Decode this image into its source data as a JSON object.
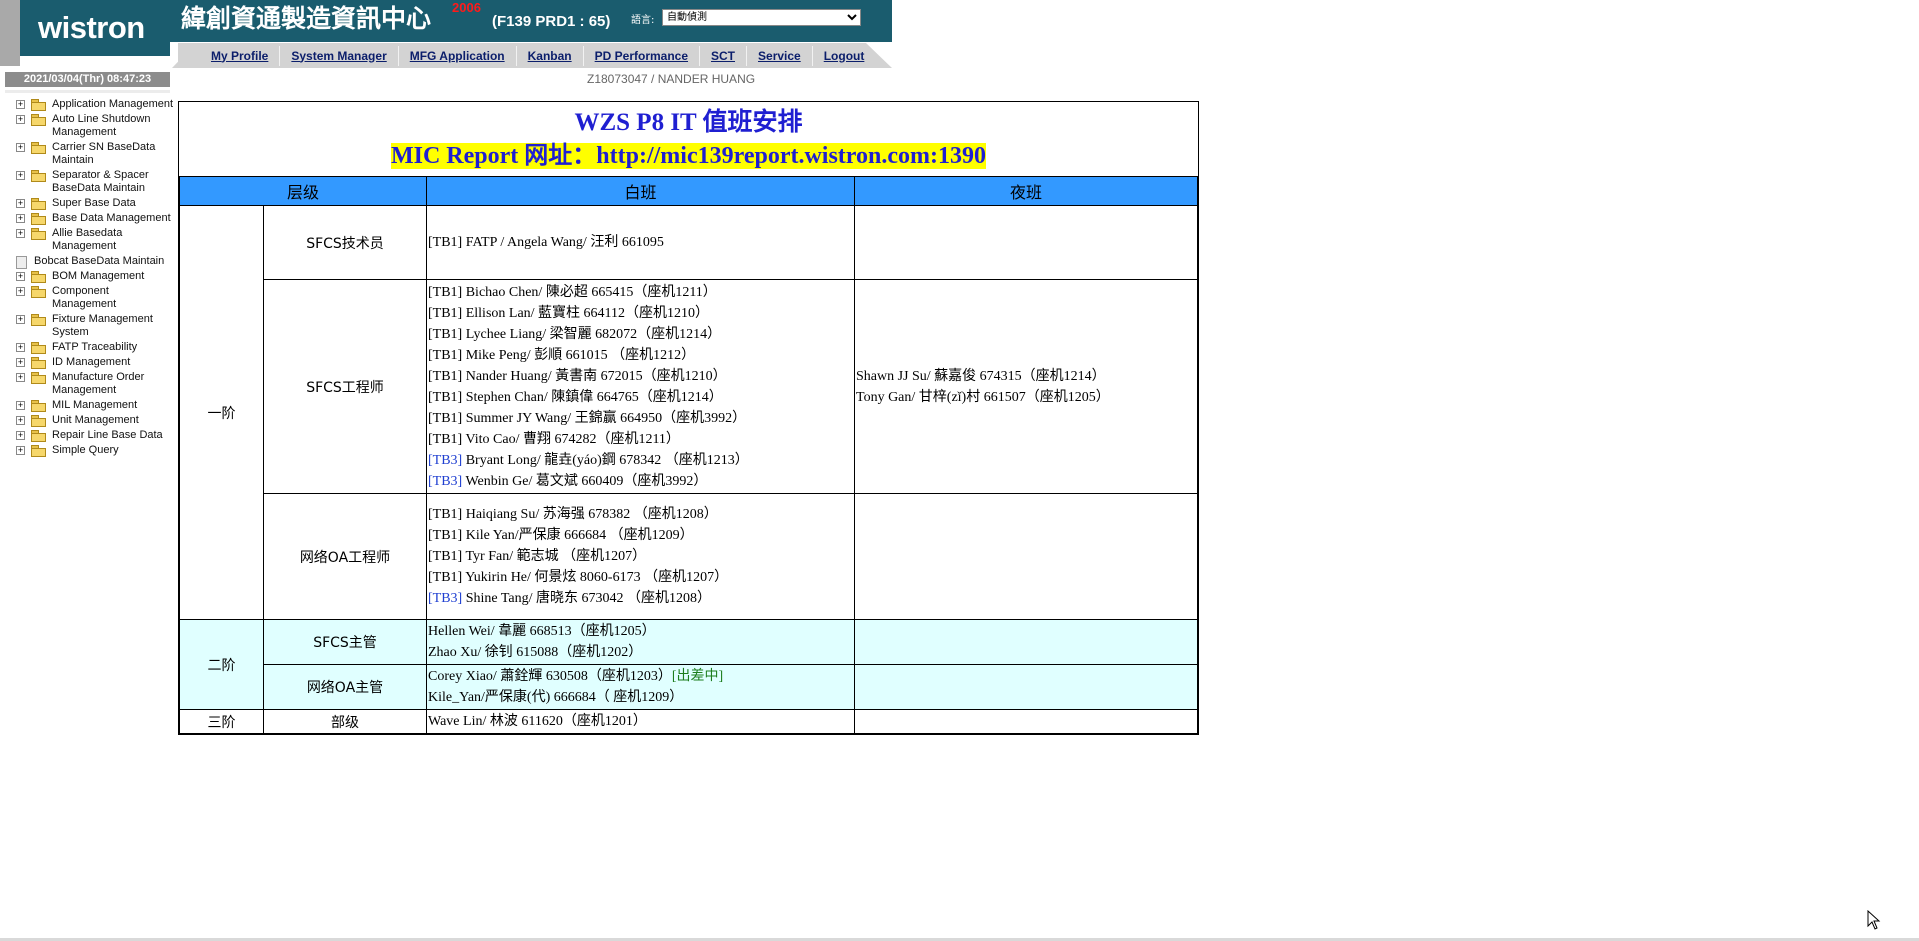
{
  "header": {
    "logo": "wistron",
    "system_title": "緯創資通製造資訊中心",
    "badge": "2006",
    "server": "(F139 PRD1 : 65)",
    "language_label": "語言:",
    "language_value": "自動偵測",
    "colors": {
      "header_bg": "#1a5c6e",
      "nav_bg": "#d3d3d3",
      "badge": "#ff1a1a"
    }
  },
  "nav": {
    "items": [
      "My Profile",
      "System Manager",
      "MFG Application",
      "Kanban",
      "PD Performance",
      "SCT",
      "Service",
      "Logout"
    ]
  },
  "datetime": "2021/03/04(Thr) 08:47:23",
  "user": "Z18073047 / NANDER HUANG",
  "sidebar": {
    "items": [
      {
        "label": "Application Management",
        "icon": "folder-icon"
      },
      {
        "label": "Auto Line Shutdown Management",
        "icon": "folder-icon"
      },
      {
        "label": "Carrier SN BaseData Maintain",
        "icon": "folder-icon"
      },
      {
        "label": "Separator & Spacer BaseData Maintain",
        "icon": "folder-icon"
      },
      {
        "label": "Super Base Data",
        "icon": "folder-icon"
      },
      {
        "label": "Base Data Management",
        "icon": "folder-icon"
      },
      {
        "label": "Allie Basedata Management",
        "icon": "folder-icon"
      },
      {
        "label": "Bobcat BaseData Maintain",
        "icon": "document-icon"
      },
      {
        "label": "BOM Management",
        "icon": "folder-icon"
      },
      {
        "label": "Component Management",
        "icon": "folder-icon"
      },
      {
        "label": "Fixture Management System",
        "icon": "folder-icon"
      },
      {
        "label": "FATP Traceability",
        "icon": "folder-icon"
      },
      {
        "label": "ID Management",
        "icon": "folder-icon"
      },
      {
        "label": "Manufacture Order Management",
        "icon": "folder-icon"
      },
      {
        "label": "MIL Management",
        "icon": "folder-icon"
      },
      {
        "label": "Unit Management",
        "icon": "folder-icon"
      },
      {
        "label": "Repair Line Base Data",
        "icon": "folder-icon"
      },
      {
        "label": "Simple Query",
        "icon": "folder-icon"
      }
    ]
  },
  "duty": {
    "title": "WZS P8 IT  值班安排",
    "report": "MIC Report 网址：http://mic139report.wistron.com:1390",
    "columns": {
      "level": "层级",
      "day": "白班",
      "night": "夜班"
    },
    "levels": {
      "l1": "一阶",
      "l2": "二阶",
      "l3": "三阶"
    },
    "roles": {
      "sfcs_tech": "SFCS技术员",
      "sfcs_eng": "SFCS工程师",
      "oa_eng": "网络OA工程师",
      "sfcs_mgr": "SFCS主管",
      "oa_mgr": "网络OA主管",
      "dept": "部级"
    },
    "tech_day": [
      "[TB1] FATP / Angela Wang/ 汪利 661095"
    ],
    "eng_day": [
      {
        "tag": "[TB1]",
        "text": " Bichao Chen/ 陳必超 665415（座机1211）"
      },
      {
        "tag": "[TB1]",
        "text": " Ellison Lan/ 藍寶柱 664112（座机1210）"
      },
      {
        "tag": "[TB1]",
        "text": " Lychee Liang/ 梁智麗 682072（座机1214）"
      },
      {
        "tag": "[TB1]",
        "text": " Mike Peng/ 彭順 661015 （座机1212）"
      },
      {
        "tag": "[TB1]",
        "text": " Nander Huang/ 黃書南 672015（座机1210）"
      },
      {
        "tag": "[TB1]",
        "text": " Stephen Chan/ 陳鎮偉 664765（座机1214）"
      },
      {
        "tag": "[TB1]",
        "text": " Summer JY Wang/ 王錦赢 664950（座机3992）"
      },
      {
        "tag": "[TB1]",
        "text": " Vito Cao/ 曹翔 674282（座机1211）"
      },
      {
        "tag": "[TB3]",
        "text": " Bryant Long/ 龍垚(yáo)鋼 678342 （座机1213）"
      },
      {
        "tag": "[TB3]",
        "text": " Wenbin Ge/ 葛文斌 660409（座机3992）"
      }
    ],
    "eng_night": [
      "Shawn JJ Su/ 蘇嘉俊 674315（座机1214）",
      "Tony Gan/ 甘梓(zǐ)村 661507（座机1205）"
    ],
    "oa_day": [
      {
        "tag": "[TB1]",
        "text": " Haiqiang Su/ 苏海强 678382 （座机1208）"
      },
      {
        "tag": "[TB1]",
        "text": " Kile Yan/严保康 666684 （座机1209）"
      },
      {
        "tag": "[TB1]",
        "text": " Tyr Fan/ 範志城 （座机1207）"
      },
      {
        "tag": "[TB1]",
        "text": " Yukirin He/ 何景炫 8060-6173 （座机1207）"
      },
      {
        "tag": "[TB3]",
        "text": " Shine Tang/ 唐晓东 673042 （座机1208）"
      }
    ],
    "sfcs_mgr_day": [
      "Hellen Wei/ 韋麗 668513（座机1205）",
      "Zhao Xu/ 徐钊 615088（座机1202）"
    ],
    "oa_mgr_day": {
      "line1": "Corey Xiao/ 蕭銓輝 630508（座机1203）",
      "trip": "[出差中]",
      "line2": "Kile_Yan/严保康(代) 666684（ 座机1209）"
    },
    "dept_day": "Wave Lin/ 林波 611620（座机1201）",
    "colors": {
      "header_row": "#3399ff",
      "title": "#1f1fd1",
      "highlight": "#ffff00",
      "mgr_rows": "#e0ffff",
      "trip": "#1d7d1d"
    }
  }
}
